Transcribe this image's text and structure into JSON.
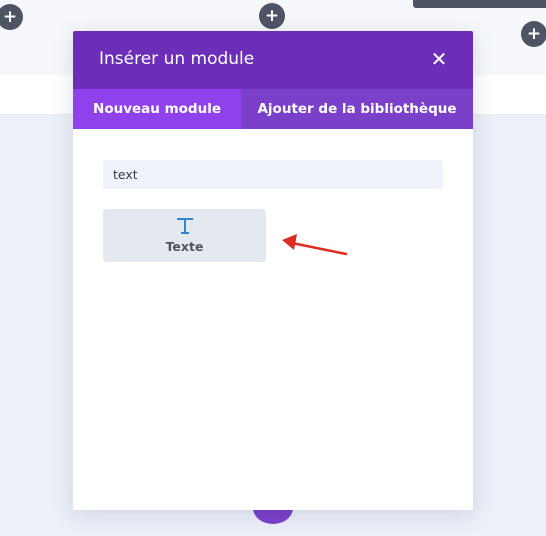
{
  "canvas": {
    "add_icon_glyph": "+",
    "icons": {
      "add": "plus-icon"
    }
  },
  "modal": {
    "title": "Insérer un module",
    "close_glyph": "✕",
    "tabs": [
      {
        "label": "Nouveau module",
        "active": true
      },
      {
        "label": "Ajouter de la bibliothèque",
        "active": false
      }
    ],
    "search": {
      "value": "text",
      "placeholder": ""
    },
    "modules": [
      {
        "label": "Texte",
        "icon": "text-t-icon"
      }
    ]
  },
  "colors": {
    "header": "#6c2eb9",
    "tab_bar": "#7b40c9",
    "tab_active": "#8f42ec",
    "icon_blue": "#2b87da",
    "arrow_red": "#e02b20",
    "dark_button": "#4d5463"
  }
}
